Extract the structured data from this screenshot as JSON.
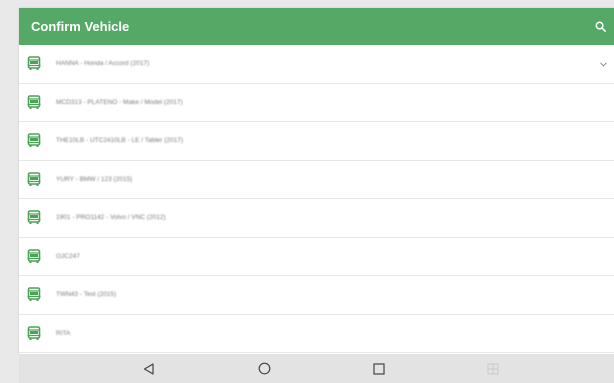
{
  "header": {
    "title": "Confirm Vehicle",
    "icon": "search-icon"
  },
  "vehicles": [
    {
      "label": "HANNA - Honda / Accord (2017)",
      "icon": "bus-icon"
    },
    {
      "label": "MCD313 - PLATENO - Make / Model (2017)",
      "icon": "bus-icon"
    },
    {
      "label": "THE10LB - UTC2410LB - LE / Tabler (2017)",
      "icon": "bus-icon"
    },
    {
      "label": "YURY - BMW / 123 (2015)",
      "icon": "bus-icon"
    },
    {
      "label": "1901 - PRO1142 - Volvo / VNC (2012)",
      "icon": "bus-icon"
    },
    {
      "label": "OJC247",
      "icon": "bus-icon"
    },
    {
      "label": "TWN43 - Test (2015)",
      "icon": "bus-icon"
    },
    {
      "label": "RITA",
      "icon": "bus-icon"
    }
  ],
  "nav": {
    "back": "back-triangle-icon",
    "home": "home-circle-icon",
    "recents": "recents-square-icon",
    "extra": "split-screen-icon"
  },
  "colors": {
    "appbar": "#55a865",
    "vehicle_icon": "#4aa456",
    "label_text": "#7a7a7a",
    "nav_bg": "#e3e3e3"
  }
}
